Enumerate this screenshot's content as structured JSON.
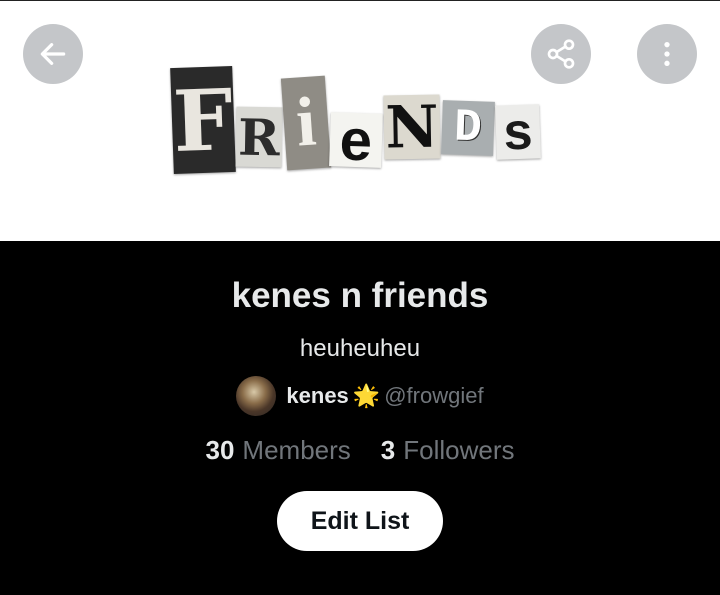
{
  "header": {
    "back_icon": "arrow-left-icon",
    "share_icon": "share-icon",
    "more_icon": "more-vertical-icon",
    "button_bg": "#c4c6c9"
  },
  "banner": {
    "letters": [
      "F",
      "R",
      "i",
      "e",
      "N",
      "D",
      "s"
    ]
  },
  "list": {
    "name": "kenes n friends",
    "description": "heuheuheu"
  },
  "owner": {
    "name": "kenes",
    "badge": "🌟",
    "handle": "@frowgief"
  },
  "stats": {
    "members_count": "30",
    "members_label": "Members",
    "followers_count": "3",
    "followers_label": "Followers"
  },
  "actions": {
    "edit_label": "Edit List"
  },
  "colors": {
    "background": "#000000",
    "primary_text": "#e7e9ea",
    "secondary_text": "#71767b",
    "button_bg": "#ffffff",
    "button_text": "#0f1419"
  }
}
